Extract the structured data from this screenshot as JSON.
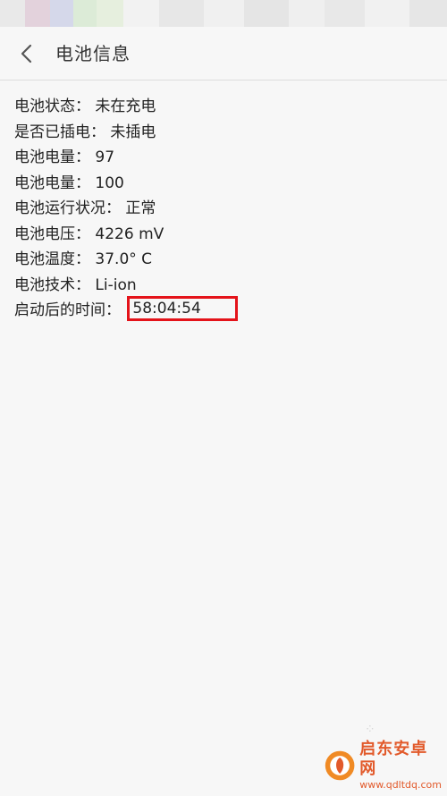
{
  "header": {
    "title": "电池信息"
  },
  "info": [
    {
      "label": "电池状态：",
      "value": "未在充电"
    },
    {
      "label": "是否已插电：",
      "value": "未插电"
    },
    {
      "label": "电池电量：",
      "value": "97"
    },
    {
      "label": "电池电量：",
      "value": "100"
    },
    {
      "label": "电池运行状况：",
      "value": "正常"
    },
    {
      "label": "电池电压：",
      "value": "4226 mV"
    },
    {
      "label": "电池温度：",
      "value": "37.0° C"
    },
    {
      "label": "电池技术：",
      "value": "Li-ion"
    },
    {
      "label": "启动后的时间：",
      "value": "58:04:54"
    }
  ],
  "watermark": {
    "name": "启东安卓网",
    "url": "www.qdltdq.com"
  },
  "colors": {
    "highlight": "#e4131a",
    "background": "#f7f7f7",
    "brand": "#e25a2b"
  }
}
